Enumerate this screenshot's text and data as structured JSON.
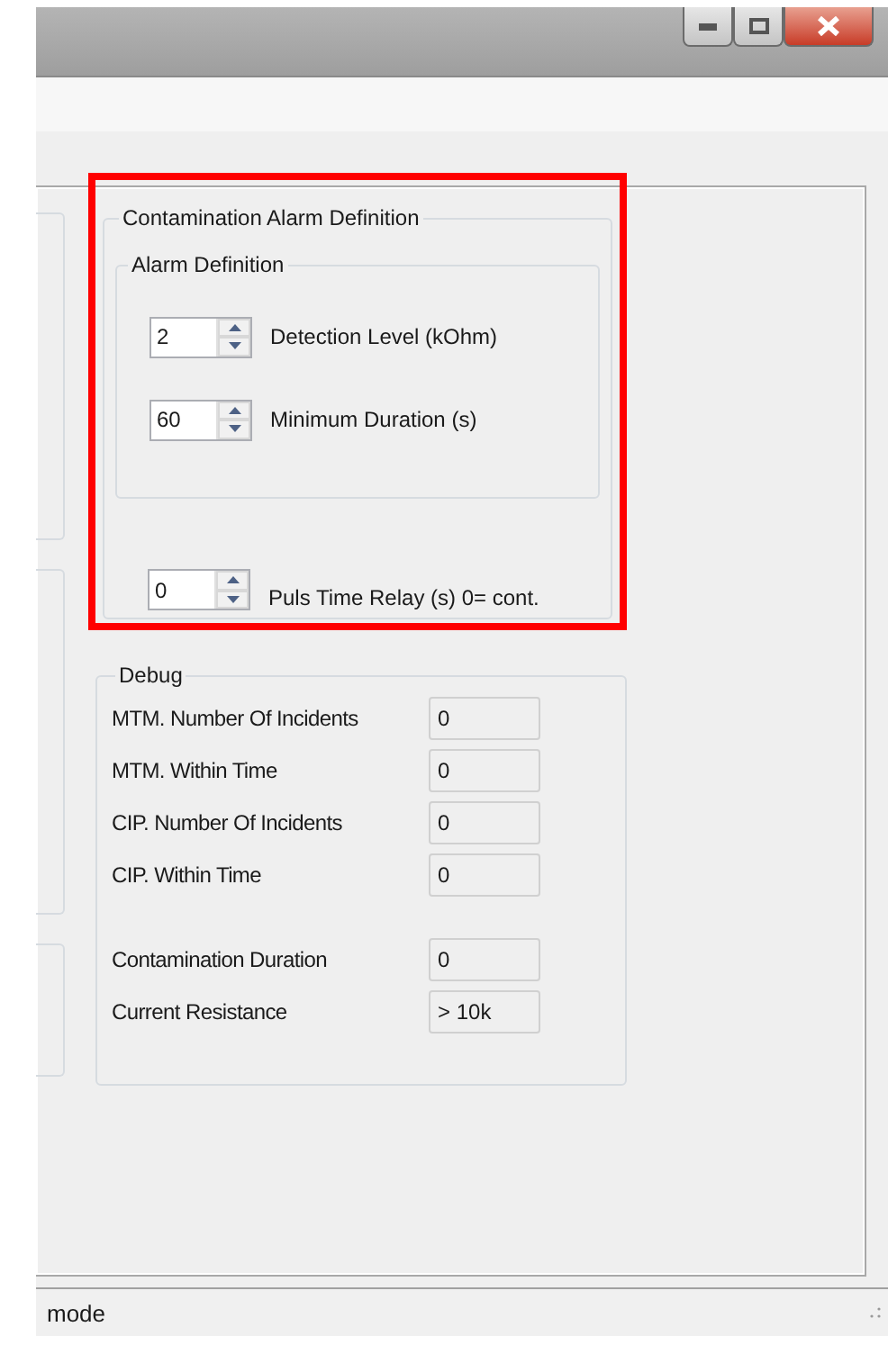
{
  "alarm_group": {
    "title": "Contamination Alarm Definition",
    "sub_group": {
      "title": "Alarm  Definition",
      "fields": [
        {
          "value": "2",
          "label": "Detection Level (kOhm)"
        },
        {
          "value": "60",
          "label": "Minimum Duration (s)"
        }
      ]
    },
    "relay": {
      "value": "0",
      "label": "Puls Time Relay (s) 0= cont."
    }
  },
  "debug": {
    "title": "Debug",
    "rows": [
      {
        "label": "MTM. Number Of Incidents",
        "value": "0"
      },
      {
        "label": "MTM. Within Time",
        "value": "0"
      },
      {
        "label": "CIP. Number Of Incidents",
        "value": "0"
      },
      {
        "label": "CIP. Within Time",
        "value": "0"
      },
      {
        "label": "Contamination  Duration",
        "value": "0",
        "gap_before": true
      },
      {
        "label": "Current Resistance",
        "value": "> 10k"
      }
    ]
  },
  "status_bar": {
    "text": "mode"
  }
}
